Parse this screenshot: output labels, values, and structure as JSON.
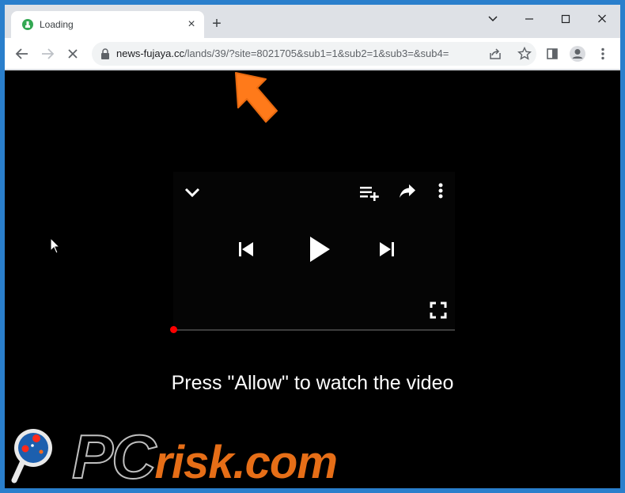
{
  "browser": {
    "tab": {
      "title": "Loading",
      "close_glyph": "×",
      "favicon": "green-loading-favicon-icon"
    },
    "new_tab_glyph": "+",
    "window_controls": {
      "dropdown": "⌄",
      "minimize": "–",
      "maximize": "☐",
      "close": "✕"
    },
    "nav": {
      "back": "←",
      "forward": "→",
      "stop": "✕"
    },
    "address": {
      "host": "news-fujaya.cc",
      "path": "/lands/39/?site=8021705&sub1=1&sub2=1&sub3=&sub4="
    }
  },
  "page": {
    "message": "Press \"Allow\" to watch the video",
    "progress_fraction": 0.0
  },
  "watermark": {
    "pc": "PC",
    "risk": "risk.com"
  },
  "colors": {
    "arrow": "#ff7a1a",
    "progress_dot": "#ff0000",
    "window_frame": "#2a7fcc"
  }
}
